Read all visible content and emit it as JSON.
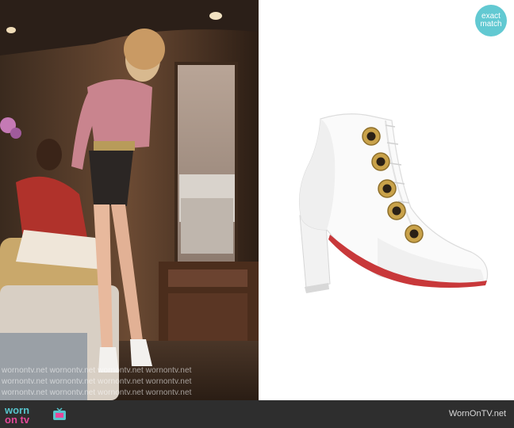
{
  "scene_photo": {
    "watermark_lines": [
      "wornontv.net   wornontv.net   wornontv.net   wornontv.net",
      "wornontv.net   wornontv.net   wornontv.net   wornontv.net",
      "wornontv.net   wornontv.net   wornontv.net   wornontv.net"
    ]
  },
  "badge": {
    "line1": "exact",
    "line2": "match"
  },
  "footer": {
    "logo_top": "worn",
    "logo_bottom": "on tv",
    "site_name": "WornOnTV.net"
  },
  "colors": {
    "badge": "#62c9d2",
    "footer_bg": "#2e2e2e",
    "logo_teal": "#57c4cc",
    "logo_pink": "#e6479a",
    "sole_red": "#c8383a"
  }
}
